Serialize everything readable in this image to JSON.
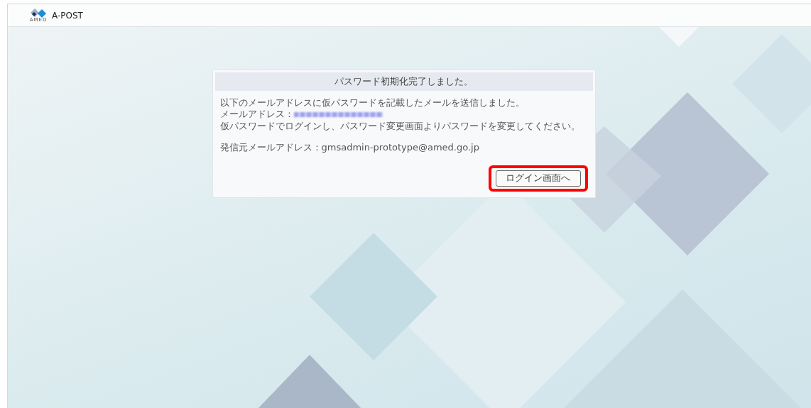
{
  "header": {
    "logo_caption": "AMED",
    "app_name": "A-POST"
  },
  "dialog": {
    "title": "パスワード初期化完了しました。",
    "lines": [
      "以下のメールアドレスに仮パスワードを記載したメールを送信しました。"
    ],
    "email_label": "メールアドレス：",
    "instruction": "仮パスワードでログインし、パスワード変更画面よりパスワードを変更してください。",
    "sender": "発信元メールアドレス：gmsadmin-prototype@amed.go.jp",
    "button": {
      "label": "ログイン画面へ",
      "highlighted": true
    }
  }
}
